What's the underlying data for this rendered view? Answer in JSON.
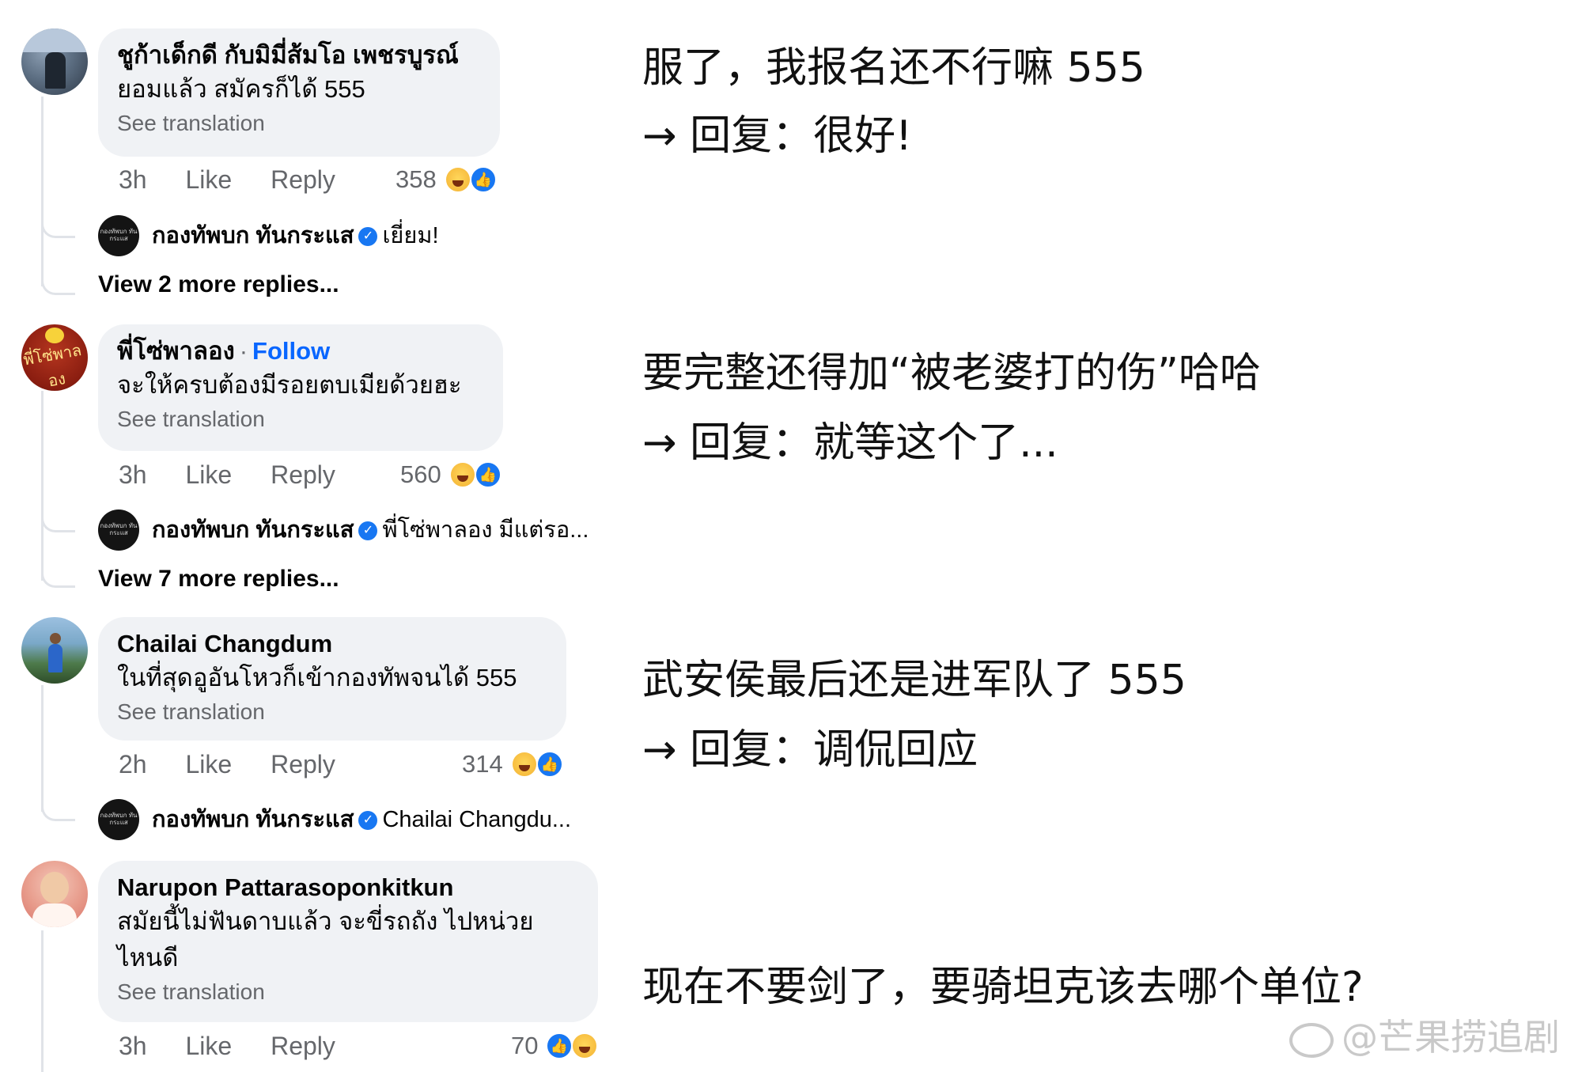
{
  "comments": [
    {
      "author": "ชูก้าเด็กดี กับมิมี่ส้มโอ เพชรบูรณ์",
      "text": "ยอมแล้ว สมัครก็ได้ 555",
      "see_translation": "See translation",
      "time": "3h",
      "like": "Like",
      "reply": "Reply",
      "reaction_count": "358",
      "page_reply": {
        "name": "กองทัพบก ทันกระแส",
        "text": "เยี่ยม!"
      },
      "view_more": "View 2 more replies..."
    },
    {
      "author": "พี่โซ่พาลอง",
      "follow_sep": "·",
      "follow": "Follow",
      "text": "จะให้ครบต้องมีรอยตบเมียด้วยฮะ",
      "see_translation": "See translation",
      "time": "3h",
      "like": "Like",
      "reply": "Reply",
      "reaction_count": "560",
      "page_reply": {
        "name": "กองทัพบก ทันกระแส",
        "text": "พี่โซ่พาลอง มีแต่รอ..."
      },
      "view_more": "View 7 more replies..."
    },
    {
      "author": "Chailai Changdum",
      "text": "ในที่สุดอูอันโหวก็เข้ากองทัพจนได้ 555",
      "see_translation": "See translation",
      "time": "2h",
      "like": "Like",
      "reply": "Reply",
      "reaction_count": "314",
      "page_reply": {
        "name": "กองทัพบก ทันกระแส",
        "text": "Chailai Changdu..."
      }
    },
    {
      "author": "Narupon Pattarasoponkitkun",
      "text_line1": "สมัยนี้ไม่ฟันดาบแล้ว จะขี่รถถัง ไปหน่วย",
      "text_line2": "ไหนดี",
      "see_translation": "See translation",
      "time": "3h",
      "like": "Like",
      "reply": "Reply",
      "reaction_count": "70"
    }
  ],
  "page_avatar_label": "กองทัพบก ทันกระแส",
  "avatar2_label": "พี่โซ่พาลอง",
  "icons": {
    "haha": "haha-reaction-icon",
    "like": "like-reaction-icon",
    "verified": "verified-badge-icon"
  },
  "annotations": [
    {
      "line1": "服了，我报名还不行嘛 555",
      "line2": "→ 回复：很好!"
    },
    {
      "line1": "要完整还得加“被老婆打的伤”哈哈",
      "line2": "→ 回复：就等这个了..."
    },
    {
      "line1": "武安侯最后还是进军队了 555",
      "line2": "→ 回复：调侃回应"
    },
    {
      "line1": "现在不要剑了，要骑坦克该去哪个单位?"
    }
  ],
  "watermark": "@芒果捞追剧",
  "colors": {
    "bubble": "#f0f2f5",
    "link_blue": "#0866ff",
    "muted": "#65676b",
    "verified_blue": "#1877f2"
  }
}
